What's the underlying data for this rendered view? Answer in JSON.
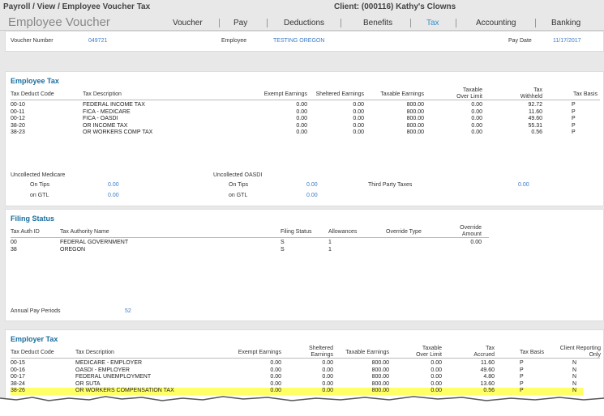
{
  "breadcrumb": "Payroll / View / Employee Voucher Tax",
  "client": "Client: (000116) Kathy's Clowns",
  "page_title": "Employee Voucher",
  "nav": [
    {
      "label": "Voucher",
      "active": false
    },
    {
      "label": "Pay",
      "active": false
    },
    {
      "label": "Deductions",
      "active": false
    },
    {
      "label": "Benefits",
      "active": false
    },
    {
      "label": "Tax",
      "active": true
    },
    {
      "label": "Accounting",
      "active": false
    },
    {
      "label": "Banking",
      "active": false
    }
  ],
  "voucher": {
    "voucher_number_label": "Voucher Number",
    "voucher_number": "049721",
    "employee_label": "Employee",
    "employee": "TESTING OREGON",
    "pay_date_label": "Pay Date",
    "pay_date": "11/17/2017"
  },
  "employee_tax": {
    "title": "Employee Tax",
    "headers": {
      "code": "Tax Deduct Code",
      "desc": "Tax Description",
      "exempt": "Exempt Earnings",
      "sheltered": "Sheltered Earnings",
      "taxable": "Taxable Earnings",
      "over_limit_1": "Taxable",
      "over_limit_2": "Over Limit",
      "withheld_1": "Tax",
      "withheld_2": "Withheld",
      "basis": "Tax Basis"
    },
    "rows": [
      {
        "code": "00-10",
        "desc": "FEDERAL INCOME TAX",
        "exempt": "0.00",
        "sheltered": "0.00",
        "taxable": "800.00",
        "over": "0.00",
        "withheld": "92.72",
        "basis": "P"
      },
      {
        "code": "00-11",
        "desc": "FICA - MEDICARE",
        "exempt": "0.00",
        "sheltered": "0.00",
        "taxable": "800.00",
        "over": "0.00",
        "withheld": "11.60",
        "basis": "P"
      },
      {
        "code": "00-12",
        "desc": "FICA - OASDI",
        "exempt": "0.00",
        "sheltered": "0.00",
        "taxable": "800.00",
        "over": "0.00",
        "withheld": "49.60",
        "basis": "P"
      },
      {
        "code": "38-20",
        "desc": "OR INCOME TAX",
        "exempt": "0.00",
        "sheltered": "0.00",
        "taxable": "800.00",
        "over": "0.00",
        "withheld": "55.31",
        "basis": "P"
      },
      {
        "code": "38-23",
        "desc": "OR WORKERS COMP TAX",
        "exempt": "0.00",
        "sheltered": "0.00",
        "taxable": "800.00",
        "over": "0.00",
        "withheld": "0.56",
        "basis": "P"
      }
    ],
    "uncollected_medicare_label": "Uncollected Medicare",
    "uncollected_oasdi_label": "Uncollected OASDI",
    "on_tips_label": "On Tips",
    "on_gtl_label": "on GTL",
    "medicare_tips": "0.00",
    "medicare_gtl": "0.00",
    "oasdi_tips": "0.00",
    "oasdi_gtl": "0.00",
    "third_party_label": "Third Party Taxes",
    "third_party": "0.00"
  },
  "filing_status": {
    "title": "Filing Status",
    "headers": {
      "auth_id": "Tax Auth ID",
      "auth_name": "Tax Authority Name",
      "status": "Filing Status",
      "allowances": "Allowances",
      "override_type": "Override Type",
      "override_amount_1": "Override",
      "override_amount_2": "Amount"
    },
    "rows": [
      {
        "auth_id": "00",
        "auth_name": "FEDERAL GOVERNMENT",
        "status": "S",
        "allowances": "1",
        "override_type": "",
        "override_amount": "0.00"
      },
      {
        "auth_id": "38",
        "auth_name": "OREGON",
        "status": "S",
        "allowances": "1",
        "override_type": "",
        "override_amount": ""
      }
    ],
    "annual_pay_periods_label": "Annual Pay Periods",
    "annual_pay_periods": "52"
  },
  "employer_tax": {
    "title": "Employer Tax",
    "headers": {
      "code": "Tax Deduct Code",
      "desc": "Tax Description",
      "exempt": "Exempt Earnings",
      "sheltered_1": "Sheltered",
      "sheltered_2": "Earnings",
      "taxable": "Taxable Earnings",
      "over_1": "Taxable",
      "over_2": "Over Limit",
      "accrued_1": "Tax",
      "accrued_2": "Accrued",
      "basis": "Tax Basis",
      "client_only_1": "Client Reporting",
      "client_only_2": "Only"
    },
    "rows": [
      {
        "code": "00-15",
        "desc": "MEDICARE - EMPLOYER",
        "exempt": "0.00",
        "sheltered": "0.00",
        "taxable": "800.00",
        "over": "0.00",
        "accrued": "11.60",
        "basis": "P",
        "client": "N",
        "highlight": false
      },
      {
        "code": "00-16",
        "desc": "OASDI - EMPLOYER",
        "exempt": "0.00",
        "sheltered": "0.00",
        "taxable": "800.00",
        "over": "0.00",
        "accrued": "49.60",
        "basis": "P",
        "client": "N",
        "highlight": false
      },
      {
        "code": "00-17",
        "desc": "FEDERAL UNEMPLOYMENT",
        "exempt": "0.00",
        "sheltered": "0.00",
        "taxable": "800.00",
        "over": "0.00",
        "accrued": "4.80",
        "basis": "P",
        "client": "N",
        "highlight": false
      },
      {
        "code": "38-24",
        "desc": "OR SUTA",
        "exempt": "0.00",
        "sheltered": "0.00",
        "taxable": "800.00",
        "over": "0.00",
        "accrued": "13.60",
        "basis": "P",
        "client": "N",
        "highlight": false
      },
      {
        "code": "38-26",
        "desc": "OR WORKERS COMPENSATION TAX",
        "exempt": "0.00",
        "sheltered": "0.00",
        "taxable": "800.00",
        "over": "0.00",
        "accrued": "0.56",
        "basis": "P",
        "client": "N",
        "highlight": true
      }
    ]
  },
  "colors": {
    "accent": "#3a7bc8",
    "section_title": "#1a6e9e",
    "highlight": "#ffff66"
  }
}
